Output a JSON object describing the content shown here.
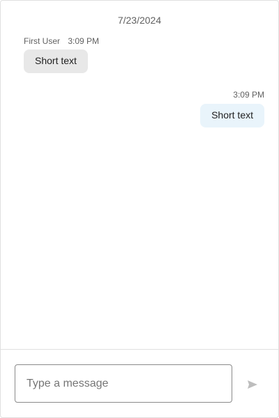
{
  "chat": {
    "date_separator": "7/23/2024",
    "messages": [
      {
        "direction": "incoming",
        "author": "First User",
        "time": "3:09 PM",
        "text": "Short text"
      },
      {
        "direction": "outgoing",
        "time": "3:09 PM",
        "text": "Short text"
      }
    ]
  },
  "composer": {
    "placeholder": "Type a message",
    "value": "",
    "send_icon": "send-icon"
  },
  "colors": {
    "incoming_bubble": "#e8e8e8",
    "outgoing_bubble": "#e9f4fb",
    "send_icon_disabled": "#bdbdbd"
  }
}
